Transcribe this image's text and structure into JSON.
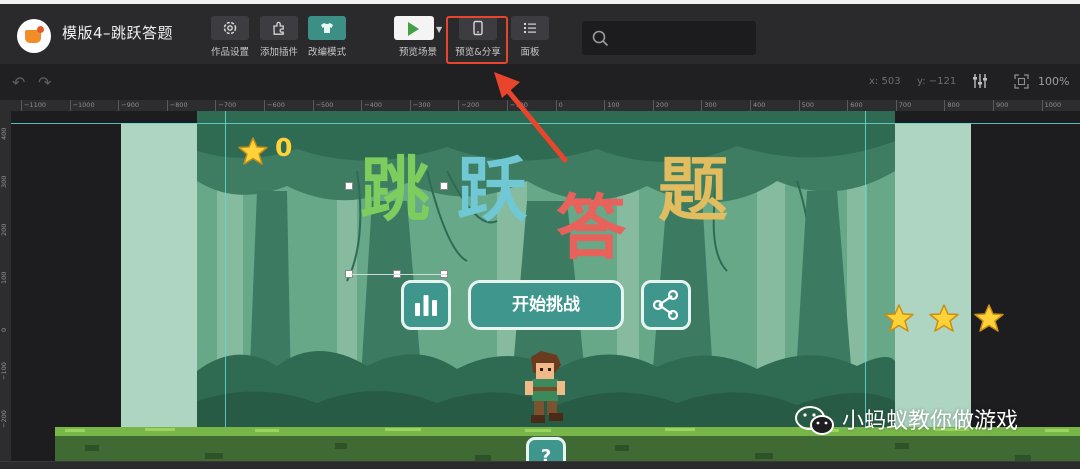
{
  "header": {
    "app_title": "模版4–跳跃答题",
    "tools": {
      "settings": "作品设置",
      "plugins": "添加插件",
      "edit_mode": "改编模式",
      "preview_scene": "预览场景",
      "preview_share": "预览&分享",
      "panel": "面板"
    },
    "search_placeholder": ""
  },
  "toolbar2": {
    "coord_x": "x: 503",
    "coord_y": "y: −121",
    "zoom": "100%"
  },
  "rulers": {
    "top": [
      "−1100",
      "−1000",
      "−900",
      "−800",
      "−700",
      "−600",
      "−500",
      "−400",
      "−300",
      "−200",
      "−100",
      "0",
      "100",
      "200",
      "300",
      "400",
      "500",
      "600",
      "700",
      "800",
      "900",
      "1000"
    ],
    "left": [
      "400",
      "300",
      "200",
      "100",
      "0",
      "−100",
      "−200"
    ]
  },
  "game": {
    "score": "0",
    "title_chars": [
      "跳",
      "跃",
      "答",
      "题"
    ],
    "start_button": "开始挑战",
    "help_button": "?",
    "level_stars": 3
  },
  "watermark": {
    "text": "小蚂蚁教你做游戏"
  },
  "colors": {
    "accent_teal": "#3e968d",
    "highlight_red": "#e8452c",
    "score_yellow": "#ffd23a"
  }
}
